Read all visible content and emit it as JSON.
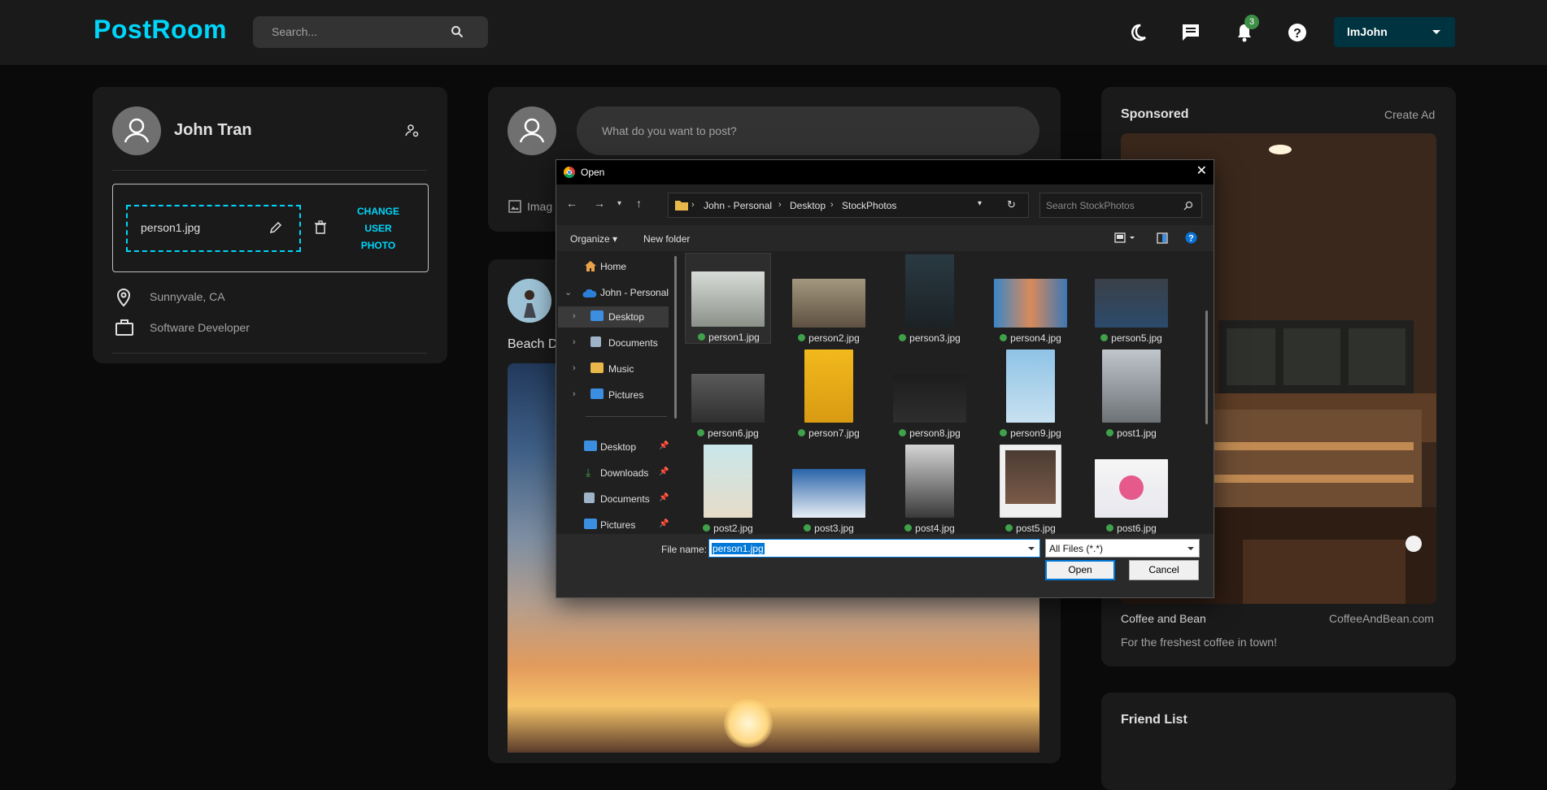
{
  "nav": {
    "logo": "PostRoom",
    "search_placeholder": "Search...",
    "notification_count": "3",
    "user_select": "lmJohn",
    "icons": [
      "moon-icon",
      "chat-icon",
      "bell-icon",
      "help-icon"
    ]
  },
  "profile": {
    "name": "John Tran",
    "photo_filename": "person1.jpg",
    "change_photo_label": "CHANGE USER PHOTO",
    "change_photo_lines": [
      "CHANGE",
      "USER",
      "PHOTO"
    ],
    "location": "Sunnyvale, CA",
    "occupation": "Software Developer"
  },
  "composer": {
    "placeholder": "What do you want to post?",
    "image_label": "Imag"
  },
  "post": {
    "title": "Beach D"
  },
  "sponsored": {
    "title": "Sponsored",
    "create_ad": "Create Ad",
    "ad_name": "Coffee and Bean",
    "ad_url": "CoffeeAndBean.com",
    "ad_description": "For the freshest coffee in town!"
  },
  "friends": {
    "title": "Friend List"
  },
  "dialog": {
    "title": "Open",
    "breadcrumb": [
      "John - Personal",
      "Desktop",
      "StockPhotos"
    ],
    "search_placeholder": "Search StockPhotos",
    "commands": {
      "organize": "Organize",
      "new_folder": "New folder"
    },
    "nav_tree": [
      {
        "label": "Home"
      },
      {
        "label": "John - Personal"
      },
      {
        "label": "Desktop"
      },
      {
        "label": "Documents"
      },
      {
        "label": "Music"
      },
      {
        "label": "Pictures"
      }
    ],
    "quick_access": [
      {
        "label": "Desktop"
      },
      {
        "label": "Downloads"
      },
      {
        "label": "Documents"
      },
      {
        "label": "Pictures"
      }
    ],
    "files": [
      "person1.jpg",
      "person2.jpg",
      "person3.jpg",
      "person4.jpg",
      "person5.jpg",
      "person6.jpg",
      "person7.jpg",
      "person8.jpg",
      "person9.jpg",
      "post1.jpg",
      "post2.jpg",
      "post3.jpg",
      "post4.jpg",
      "post5.jpg",
      "post6.jpg"
    ],
    "selected_file": "person1.jpg",
    "file_name_label": "File name:",
    "file_name_value": "person1.jpg",
    "file_type": "All Files (*.*)",
    "open_button": "Open",
    "cancel_button": "Cancel"
  },
  "colors": {
    "accent": "#00d5fa",
    "panel": "#1a1a1a",
    "background": "#0a0a0a",
    "user_select": "#003340",
    "badge": "#3d8f45",
    "windows_blue": "#0078d7"
  }
}
